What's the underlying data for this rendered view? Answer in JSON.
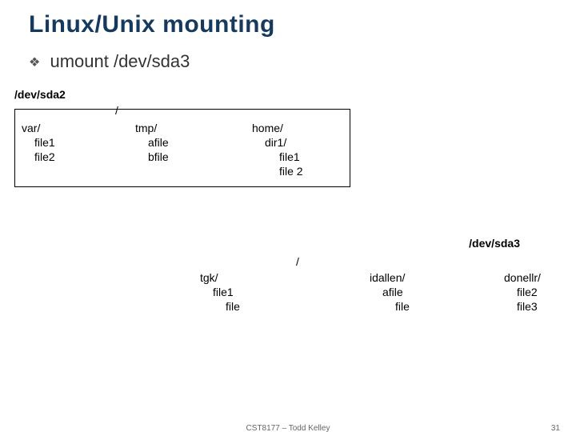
{
  "title": "Linux/Unix mounting",
  "bullet": "umount /dev/sda3",
  "dev1_label": "/dev/sda2",
  "dev2_label": "/dev/sda3",
  "box1": {
    "root": "/",
    "col1": {
      "dir": "var/",
      "l1": "file1",
      "l2": "file2"
    },
    "col2": {
      "dir": "tmp/",
      "l1": "afile",
      "l2": "bfile"
    },
    "col3": {
      "dir": "home/",
      "sub": "dir1/",
      "l1": "file1",
      "l2": "file 2"
    }
  },
  "box2": {
    "root": "/",
    "col1": {
      "dir": "tgk/",
      "l1": "file1",
      "l2": "file"
    },
    "col2": {
      "dir": "idallen/",
      "l1": "afile",
      "l2": "file"
    },
    "col3": {
      "dir": "donellr/",
      "l1": "file2",
      "l2": "file3"
    }
  },
  "footer": {
    "center": "CST8177 – Todd Kelley",
    "page": "31"
  }
}
